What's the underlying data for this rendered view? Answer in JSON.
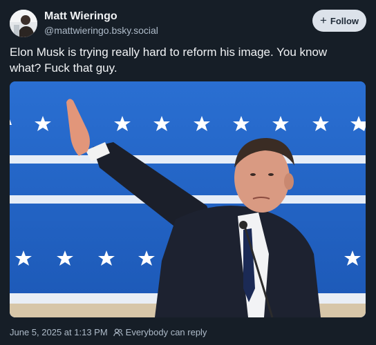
{
  "author": {
    "display_name": "Matt Wieringo",
    "handle": "@mattwieringo.bsky.social"
  },
  "follow_button": {
    "icon": "plus-icon",
    "label": "Follow"
  },
  "post": {
    "text": "Elon Musk is trying really hard to reform his image. You know what? Fuck that guy."
  },
  "footer": {
    "timestamp": "June 5, 2025 at 1:13 PM",
    "reply_settings": {
      "icon": "people-icon",
      "label": "Everybody can reply"
    }
  },
  "colors": {
    "background": "#161e27",
    "follow_button_bg": "#dce2ea",
    "muted_text": "#aebbc9"
  }
}
